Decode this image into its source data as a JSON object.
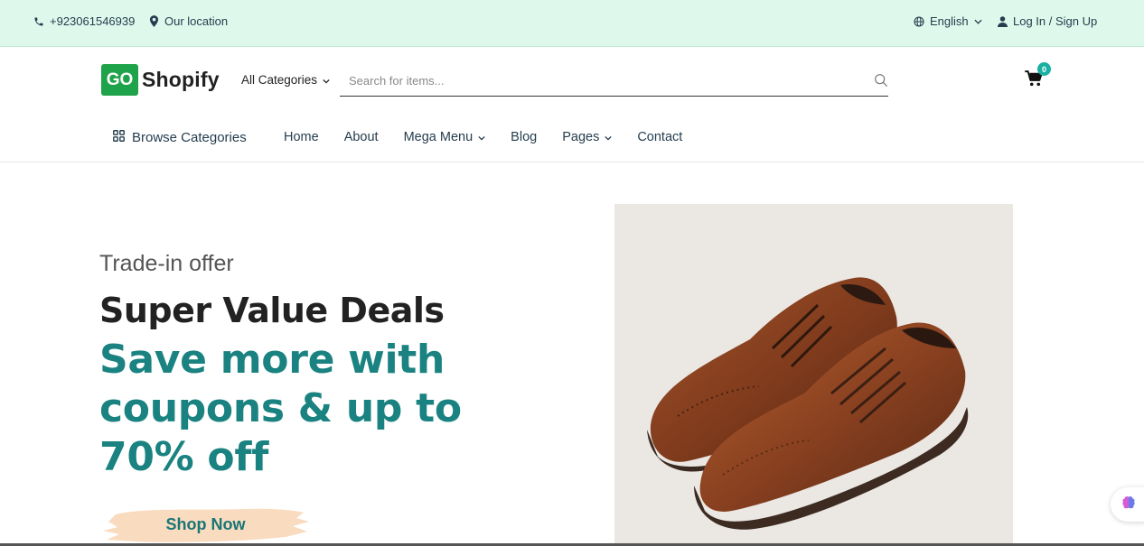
{
  "topbar": {
    "phone": "+923061546939",
    "location": "Our location",
    "language": "English",
    "login": "Log In / Sign Up",
    "icons": {
      "phone": "phone-icon",
      "location": "map-pin-icon",
      "language": "globe-icon",
      "user": "user-icon"
    }
  },
  "header": {
    "logo_badge": "GO",
    "logo_text": "Shopify",
    "category_select": "All Categories",
    "search_placeholder": "Search for items...",
    "cart_count": "0",
    "browse_label": "Browse Categories",
    "nav": [
      {
        "label": "Home",
        "has_dropdown": false
      },
      {
        "label": "About",
        "has_dropdown": false
      },
      {
        "label": "Mega Menu",
        "has_dropdown": true
      },
      {
        "label": "Blog",
        "has_dropdown": false
      },
      {
        "label": "Pages",
        "has_dropdown": true
      },
      {
        "label": "Contact",
        "has_dropdown": false
      }
    ]
  },
  "hero": {
    "subtitle": "Trade-in offer",
    "title": "Super Value Deals",
    "promo": "Save more with coupons & up to 70% off",
    "button": "Shop Now",
    "image": "brown-leather-brogue-shoes"
  },
  "colors": {
    "topbar_bg": "#def9ec",
    "brand_green": "#1fa34a",
    "promo_teal": "#1a8280",
    "badge_teal": "#1ab0a3",
    "button_brush": "#f9dcc0"
  }
}
